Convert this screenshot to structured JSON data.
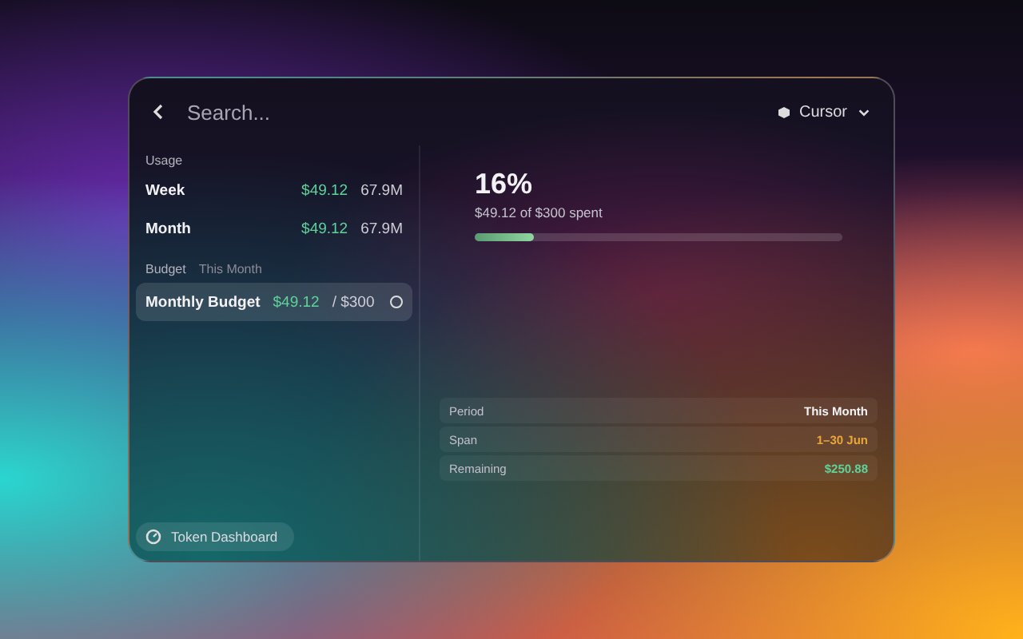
{
  "search": {
    "placeholder": "Search..."
  },
  "account": {
    "label": "Cursor"
  },
  "usage": {
    "heading": "Usage",
    "rows": [
      {
        "label": "Week",
        "cost": "$49.12",
        "tokens": "67.9M"
      },
      {
        "label": "Month",
        "cost": "$49.12",
        "tokens": "67.9M"
      }
    ]
  },
  "budget": {
    "heading": "Budget",
    "period": "This Month",
    "items": [
      {
        "label": "Monthly Budget",
        "spent": "$49.12",
        "limit": "/ $300",
        "selected": true,
        "checked": false
      }
    ]
  },
  "summary": {
    "percent": "16%",
    "caption": "$49.12 of $300 spent",
    "level": 0.16
  },
  "details": [
    {
      "label": "Period",
      "value": "This Month",
      "color": "#f2f2f5"
    },
    {
      "label": "Span",
      "value": "1–30 Jun",
      "color": "#e8a53a"
    },
    {
      "label": "Remaining",
      "value": "$250.88",
      "color": "#5fd39a"
    }
  ],
  "footer": {
    "label": "Token Dashboard"
  }
}
